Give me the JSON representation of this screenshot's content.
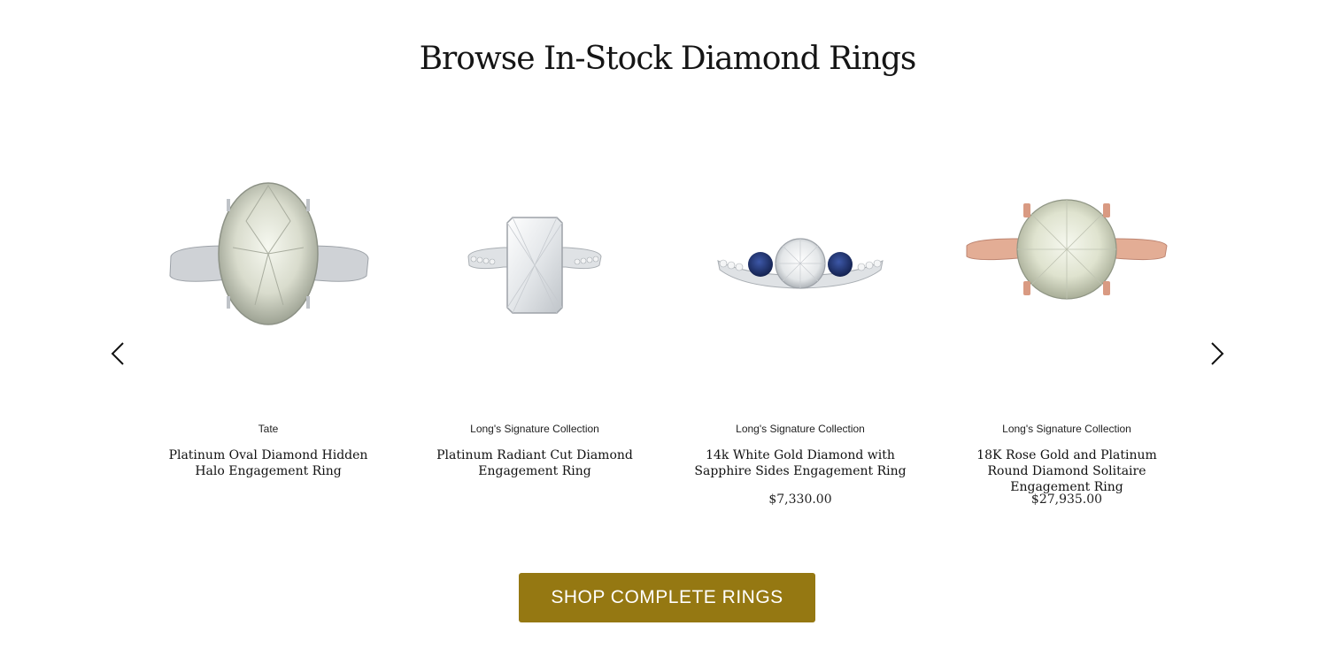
{
  "section": {
    "title": "Browse In-Stock Diamond Rings"
  },
  "carousel": {
    "prev_icon": "chevron-left-icon",
    "next_icon": "chevron-right-icon",
    "products": [
      {
        "brand": "Tate",
        "name": "Platinum Oval Diamond Hidden Halo Engagement Ring",
        "price": "",
        "metal_color": "#c9ccd0",
        "stone": "oval diamond"
      },
      {
        "brand": "Long's Signature Collection",
        "name": "Platinum Radiant Cut Diamond Engagement Ring",
        "price": "",
        "metal_color": "#c9ccd0",
        "stone": "radiant cut diamond"
      },
      {
        "brand": "Long's Signature Collection",
        "name": "14k White Gold Diamond with Sapphire Sides Engagement Ring",
        "price": "$7,330.00",
        "metal_color": "#c9ccd0",
        "accent_color": "#1c2f6e",
        "stone": "round diamond with sapphires"
      },
      {
        "brand": "Long's Signature Collection",
        "name": "18K Rose Gold and Platinum Round Diamond Solitaire Engagement Ring",
        "price": "$27,935.00",
        "metal_color": "#d9a089",
        "stone": "round diamond"
      }
    ]
  },
  "cta": {
    "label": "SHOP COMPLETE RINGS",
    "color": "#957812"
  }
}
